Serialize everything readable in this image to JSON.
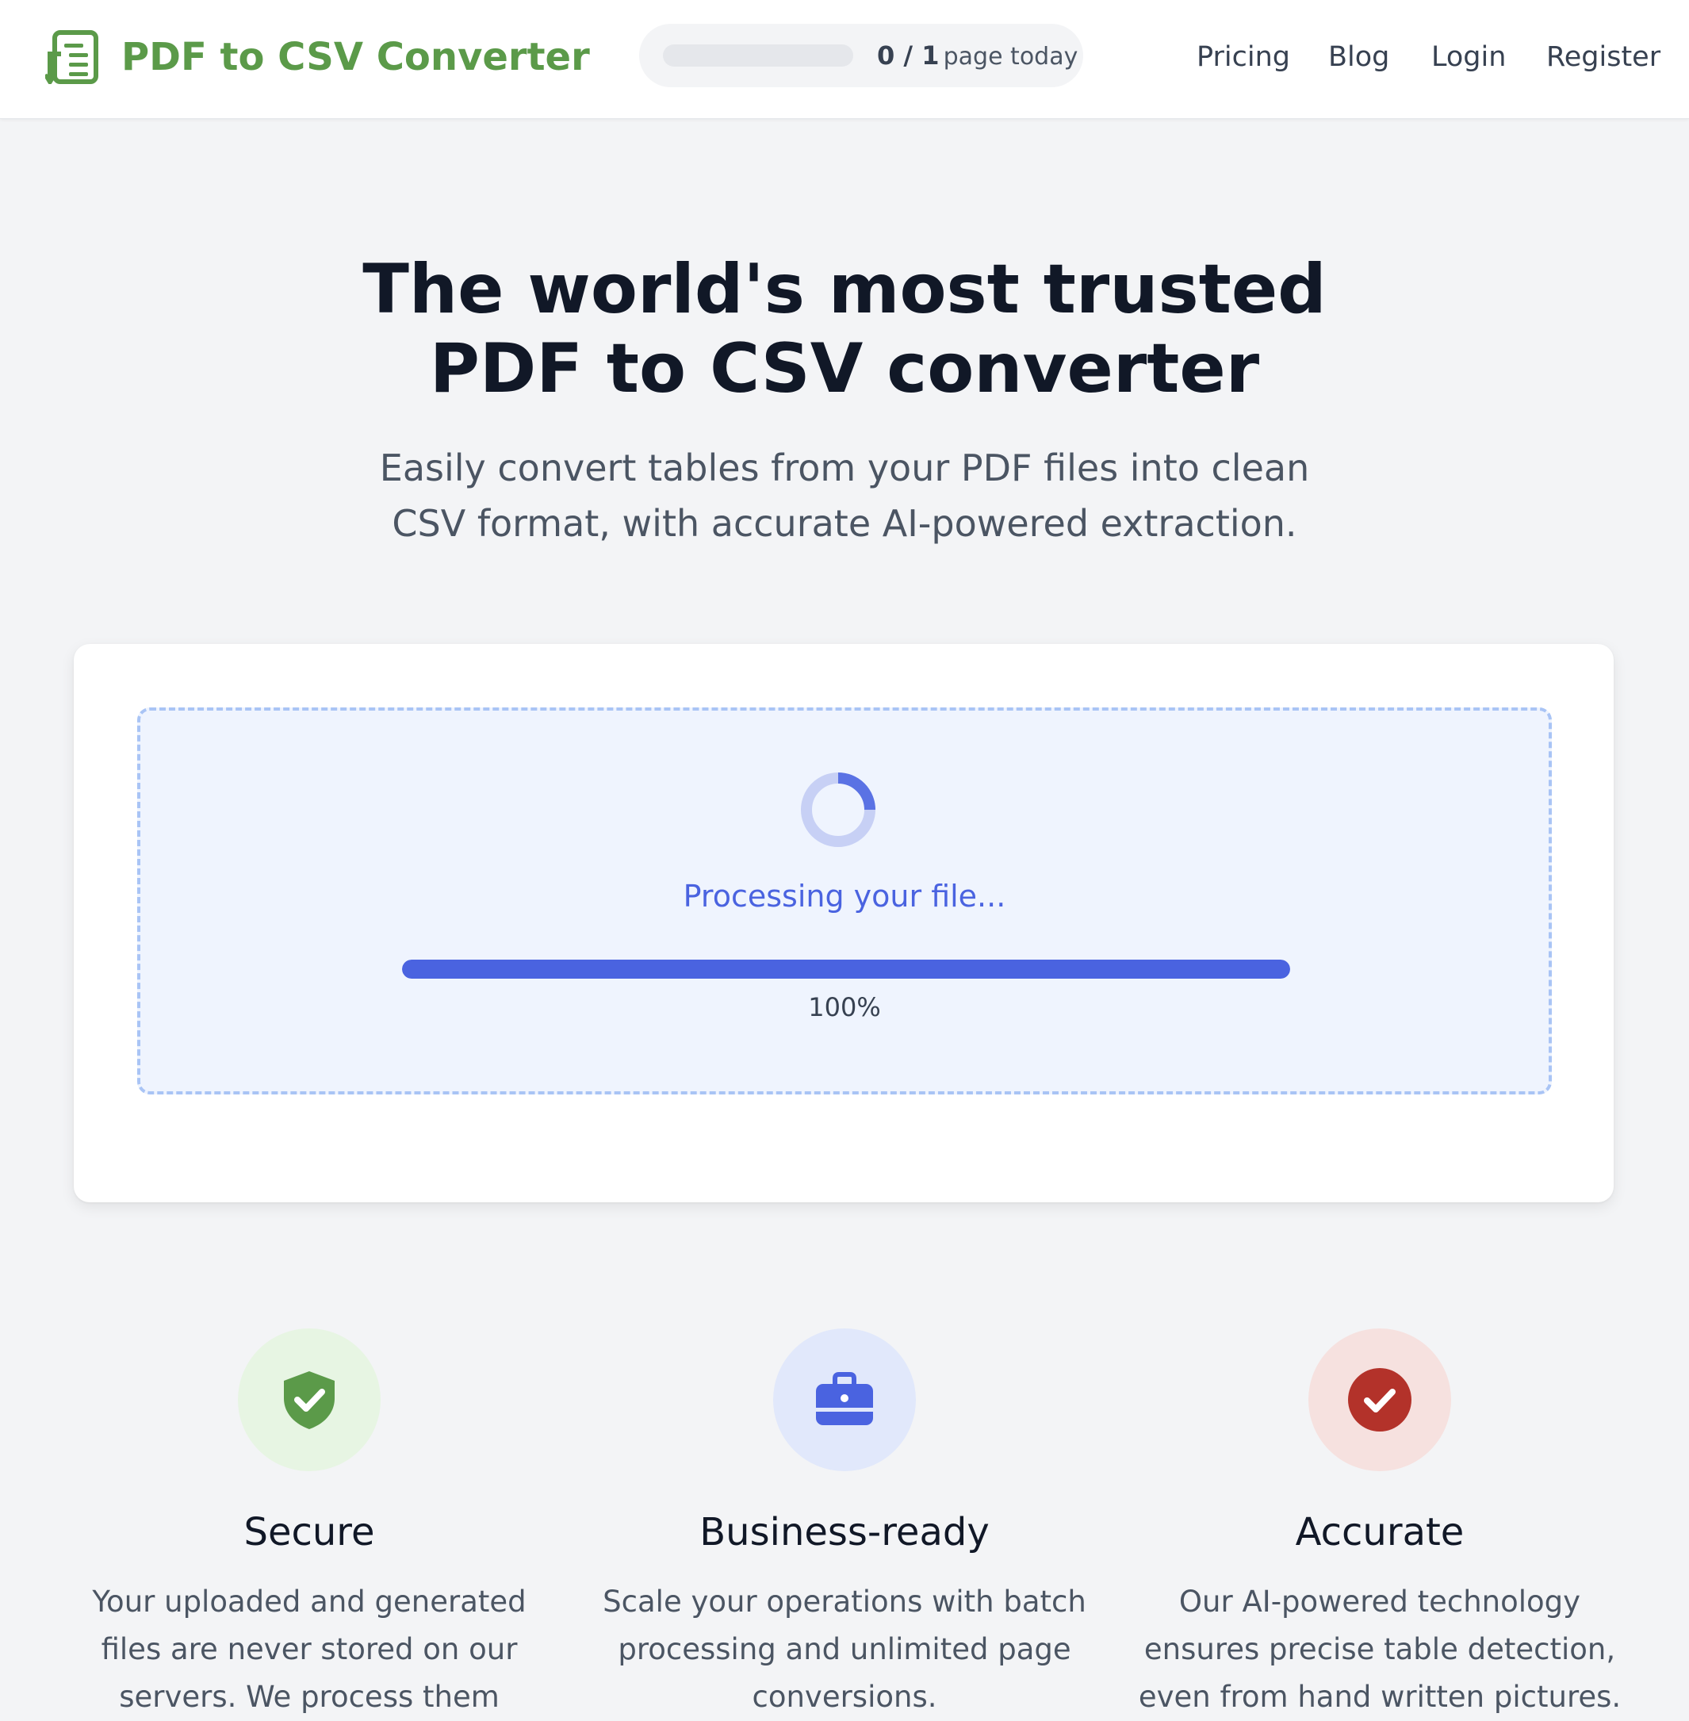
{
  "header": {
    "brand": "PDF to CSV Converter",
    "usage": {
      "count": "0 / 1",
      "unit": "page today",
      "fraction": 0
    },
    "nav": {
      "pricing": "Pricing",
      "blog": "Blog",
      "login": "Login",
      "register": "Register"
    }
  },
  "hero": {
    "title_line1": "The world's most trusted",
    "title_line2": "PDF to CSV converter",
    "subtitle_line1": "Easily convert tables from your PDF files into clean",
    "subtitle_line2": "CSV format, with accurate AI-powered extraction."
  },
  "upload": {
    "status": "Processing your file...",
    "progress_percent": 100,
    "progress_label": "100%"
  },
  "features": [
    {
      "icon": "shield-check-icon",
      "title": "Secure",
      "desc_lines": [
        "Your uploaded and generated",
        "files are never stored on our",
        "servers. We process them"
      ]
    },
    {
      "icon": "briefcase-icon",
      "title": "Business-ready",
      "desc_lines": [
        "Scale your operations with batch",
        "processing and unlimited page",
        "conversions."
      ]
    },
    {
      "icon": "check-circle-icon",
      "title": "Accurate",
      "desc_lines": [
        "Our AI-powered technology",
        "ensures precise table detection,",
        "even from hand written pictures."
      ]
    }
  ],
  "colors": {
    "brand_green": "#5b9a49",
    "accent_blue": "#4a63e0",
    "accurate_red": "#b3322a",
    "page_bg": "#f3f4f6"
  }
}
